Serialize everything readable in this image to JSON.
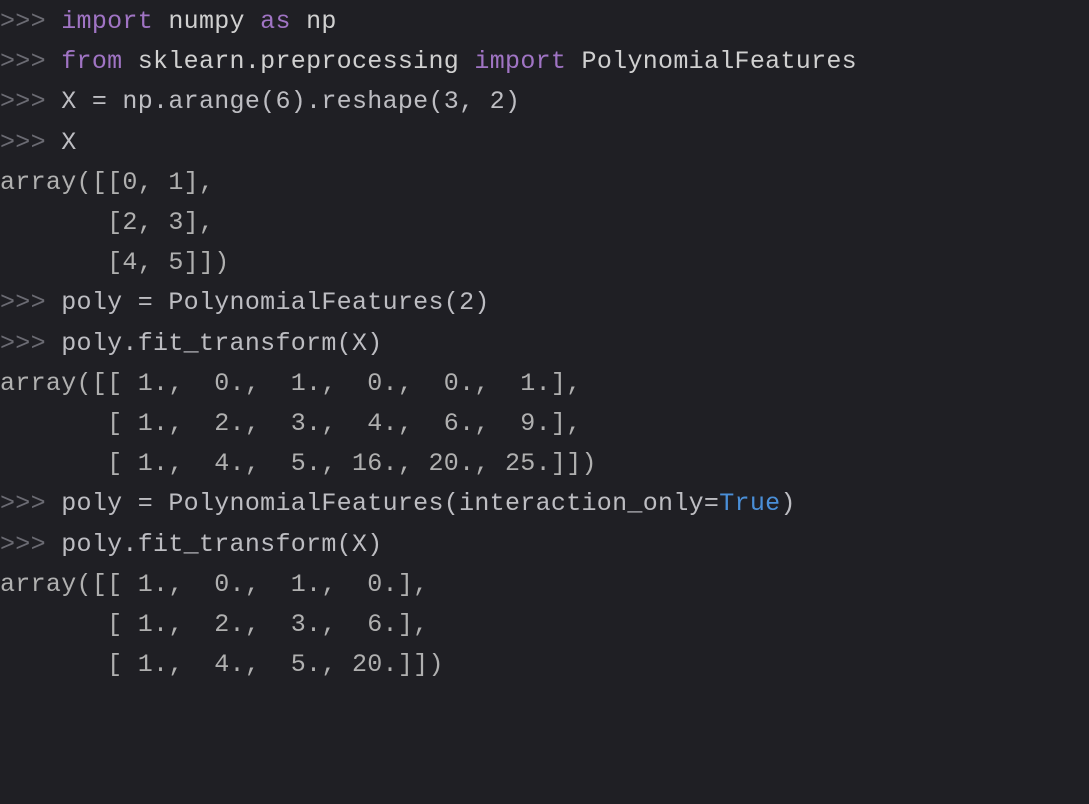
{
  "lines": [
    {
      "kind": "in",
      "segments": [
        {
          "t": ">>> ",
          "c": "prompt"
        },
        {
          "t": "import",
          "c": "kw"
        },
        {
          "t": " numpy ",
          "c": "mod"
        },
        {
          "t": "as",
          "c": "kw"
        },
        {
          "t": " np",
          "c": "ascl"
        }
      ]
    },
    {
      "kind": "in",
      "segments": [
        {
          "t": ">>> ",
          "c": "prompt"
        },
        {
          "t": "from",
          "c": "kw"
        },
        {
          "t": " sklearn.preprocessing ",
          "c": "mod"
        },
        {
          "t": "import",
          "c": "kw"
        },
        {
          "t": " PolynomialFeatures",
          "c": "ascl"
        }
      ]
    },
    {
      "kind": "in",
      "segments": [
        {
          "t": ">>> ",
          "c": "prompt"
        },
        {
          "t": "X = np.arange(6).reshape(3, 2)",
          "c": "code-text"
        }
      ]
    },
    {
      "kind": "in",
      "segments": [
        {
          "t": ">>> ",
          "c": "prompt"
        },
        {
          "t": "X",
          "c": "code-text"
        }
      ]
    },
    {
      "kind": "out",
      "segments": [
        {
          "t": "array([[0, 1],",
          "c": "out"
        }
      ]
    },
    {
      "kind": "out",
      "segments": [
        {
          "t": "       [2, 3],",
          "c": "out"
        }
      ]
    },
    {
      "kind": "out",
      "segments": [
        {
          "t": "       [4, 5]])",
          "c": "out"
        }
      ]
    },
    {
      "kind": "in",
      "segments": [
        {
          "t": ">>> ",
          "c": "prompt"
        },
        {
          "t": "poly = PolynomialFeatures(2)",
          "c": "code-text"
        }
      ]
    },
    {
      "kind": "in",
      "segments": [
        {
          "t": ">>> ",
          "c": "prompt"
        },
        {
          "t": "poly.fit_transform(X)",
          "c": "code-text"
        }
      ]
    },
    {
      "kind": "out",
      "segments": [
        {
          "t": "array([[ 1.,  0.,  1.,  0.,  0.,  1.],",
          "c": "out"
        }
      ]
    },
    {
      "kind": "out",
      "segments": [
        {
          "t": "       [ 1.,  2.,  3.,  4.,  6.,  9.],",
          "c": "out"
        }
      ]
    },
    {
      "kind": "out",
      "segments": [
        {
          "t": "       [ 1.,  4.,  5., 16., 20., 25.]])",
          "c": "out"
        }
      ]
    },
    {
      "kind": "in",
      "segments": [
        {
          "t": ">>> ",
          "c": "prompt"
        },
        {
          "t": "poly = PolynomialFeatures(interaction_only=",
          "c": "code-text"
        },
        {
          "t": "True",
          "c": "true"
        },
        {
          "t": ")",
          "c": "code-text"
        }
      ]
    },
    {
      "kind": "in",
      "segments": [
        {
          "t": ">>> ",
          "c": "prompt"
        },
        {
          "t": "poly.fit_transform(X)",
          "c": "code-text"
        }
      ]
    },
    {
      "kind": "out",
      "segments": [
        {
          "t": "array([[ 1.,  0.,  1.,  0.],",
          "c": "out"
        }
      ]
    },
    {
      "kind": "out",
      "segments": [
        {
          "t": "       [ 1.,  2.,  3.,  6.],",
          "c": "out"
        }
      ]
    },
    {
      "kind": "out",
      "segments": [
        {
          "t": "       [ 1.,  4.,  5., 20.]])",
          "c": "out"
        }
      ]
    }
  ]
}
